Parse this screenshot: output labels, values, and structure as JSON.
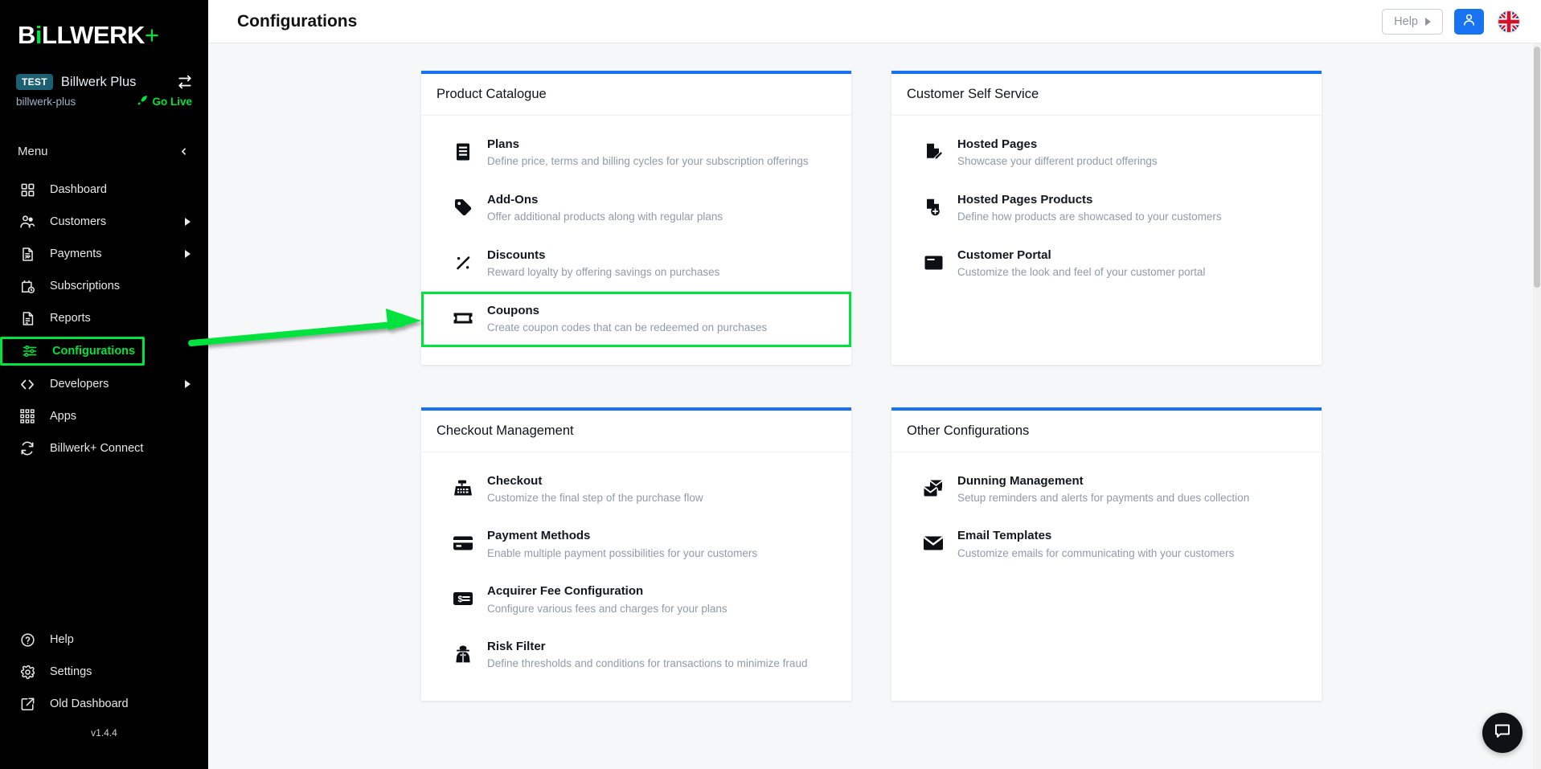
{
  "sidebar": {
    "logo": {
      "pre": "B",
      "dot": "i",
      "mid": "LLWERK",
      "plus": "+"
    },
    "tenant": {
      "badge": "TEST",
      "name": "Billwerk Plus",
      "slug": "billwerk-plus",
      "go_live": "Go Live",
      "swap_icon": "swap-icon",
      "rocket_icon": "rocket-icon"
    },
    "menu_label": "Menu",
    "collapse_icon": "chevron-left-icon",
    "items": [
      {
        "label": "Dashboard",
        "icon": "grid-icon",
        "has_caret": false,
        "active": false
      },
      {
        "label": "Customers",
        "icon": "users-icon",
        "has_caret": true,
        "active": false
      },
      {
        "label": "Payments",
        "icon": "invoice-icon",
        "has_caret": true,
        "active": false
      },
      {
        "label": "Subscriptions",
        "icon": "calendar-clock-icon",
        "has_caret": false,
        "active": false
      },
      {
        "label": "Reports",
        "icon": "document-icon",
        "has_caret": false,
        "active": false
      },
      {
        "label": "Configurations",
        "icon": "sliders-icon",
        "has_caret": false,
        "active": true
      },
      {
        "label": "Developers",
        "icon": "code-icon",
        "has_caret": true,
        "active": false
      },
      {
        "label": "Apps",
        "icon": "apps-grid-icon",
        "has_caret": false,
        "active": false
      },
      {
        "label": "Billwerk+ Connect",
        "icon": "sync-icon",
        "has_caret": false,
        "active": false
      }
    ],
    "bottom_items": [
      {
        "label": "Help",
        "icon": "question-circle-icon"
      },
      {
        "label": "Settings",
        "icon": "gear-icon"
      },
      {
        "label": "Old Dashboard",
        "icon": "external-link-icon"
      }
    ],
    "version": "v1.4.4"
  },
  "topbar": {
    "title": "Configurations",
    "help_label": "Help",
    "help_caret_icon": "caret-right-icon",
    "user_icon": "user-icon",
    "flag_icon": "uk-flag-icon"
  },
  "cards": [
    {
      "title": "Product Catalogue",
      "rows": [
        {
          "icon": "plans-icon",
          "title": "Plans",
          "desc": "Define price, terms and billing cycles for your subscription offerings",
          "highlight": false
        },
        {
          "icon": "tag-icon",
          "title": "Add-Ons",
          "desc": "Offer additional products along with regular plans",
          "highlight": false
        },
        {
          "icon": "percent-icon",
          "title": "Discounts",
          "desc": "Reward loyalty by offering savings on purchases",
          "highlight": false
        },
        {
          "icon": "ticket-icon",
          "title": "Coupons",
          "desc": "Create coupon codes that can be redeemed on purchases",
          "highlight": true
        }
      ]
    },
    {
      "title": "Customer Self Service",
      "rows": [
        {
          "icon": "page-edit-icon",
          "title": "Hosted Pages",
          "desc": "Showcase your different product offerings",
          "highlight": false
        },
        {
          "icon": "page-plus-icon",
          "title": "Hosted Pages Products",
          "desc": "Define how products are showcased to your customers",
          "highlight": false
        },
        {
          "icon": "window-icon",
          "title": "Customer Portal",
          "desc": "Customize the look and feel of your customer portal",
          "highlight": false
        }
      ]
    },
    {
      "title": "Checkout Management",
      "rows": [
        {
          "icon": "register-icon",
          "title": "Checkout",
          "desc": "Customize the final step of the purchase flow",
          "highlight": false
        },
        {
          "icon": "credit-card-icon",
          "title": "Payment Methods",
          "desc": "Enable multiple payment possibilities for your customers",
          "highlight": false
        },
        {
          "icon": "fee-icon",
          "title": "Acquirer Fee Configuration",
          "desc": "Configure various fees and charges for your plans",
          "highlight": false
        },
        {
          "icon": "detective-icon",
          "title": "Risk Filter",
          "desc": "Define thresholds and conditions for transactions to minimize fraud",
          "highlight": false
        }
      ]
    },
    {
      "title": "Other Configurations",
      "rows": [
        {
          "icon": "dunning-icon",
          "title": "Dunning Management",
          "desc": "Setup reminders and alerts for payments and dues collection",
          "highlight": false
        },
        {
          "icon": "envelope-icon",
          "title": "Email Templates",
          "desc": "Customize emails for communicating with your customers",
          "highlight": false
        }
      ]
    }
  ],
  "chat": {
    "icon": "chat-bubble-icon"
  },
  "annotations": {
    "arrow_color": "#00e23c",
    "highlight_color": "#00e23c"
  },
  "colors": {
    "accent_blue": "#1773f0",
    "brand_green": "#00e23c",
    "sidebar_bg": "#000000",
    "page_bg": "#f6f7f9"
  }
}
